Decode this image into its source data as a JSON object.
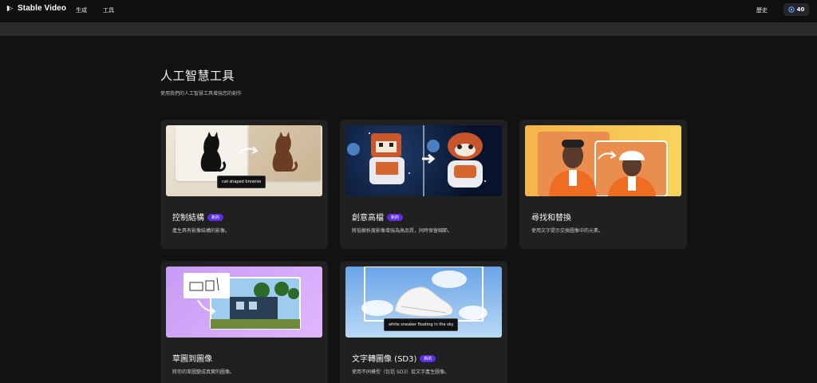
{
  "app": {
    "name": "Stable Video",
    "nav": {
      "generate": "生成",
      "tools": "工具",
      "history": "歷史"
    },
    "credits": "40",
    "colors": {
      "accent": "#5d2ee0",
      "background": "#121212",
      "card": "#202020"
    }
  },
  "page": {
    "title": "人工智慧工具",
    "subtitle": "使用我們的人工智慧工具增強您的創作"
  },
  "tools": [
    {
      "title": "控制結構",
      "badge": "新的",
      "desc": "產生具有影像結構的影像。",
      "prompt": "cat-shaped brownie",
      "icon": "cat-silhouette-to-brownie"
    },
    {
      "title": "創意高檔",
      "badge": "新的",
      "desc": "將低解析度影像增強為高品質，同時保留細節。",
      "icon": "red-panda-astronaut-upscale"
    },
    {
      "title": "尋找和替換",
      "desc": "使用文字提示交換圖像中的元素。",
      "icon": "woman-hat-replace"
    },
    {
      "title": "草圖到圖像",
      "desc": "將你的草圖變成真實的圖像。",
      "icon": "sketch-to-tiny-house"
    },
    {
      "title": "文字轉圖像 (SD3)",
      "badge": "新的",
      "desc": "使用不同模型（包括 SD3）從文字產生圖像。",
      "prompt": "white sneaker floating in the sky",
      "icon": "sneaker-in-sky"
    }
  ]
}
